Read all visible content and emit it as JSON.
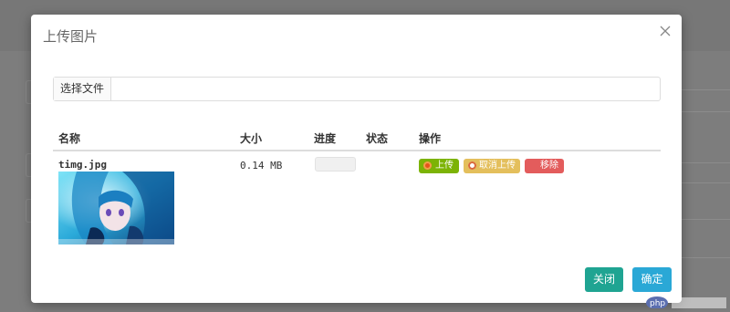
{
  "dialog": {
    "title": "上传图片",
    "close_icon": "close-icon"
  },
  "picker": {
    "button_label": "选择文件",
    "file_name": ""
  },
  "table": {
    "headers": {
      "name": "名称",
      "size": "大小",
      "progress": "进度",
      "status": "状态",
      "action": "操作"
    },
    "rows": [
      {
        "file_name": "timg.jpg",
        "file_size": "0.14 MB",
        "progress_fraction": 0,
        "status": "",
        "actions": {
          "upload": "上传",
          "cancel": "取消上传",
          "remove": "移除"
        }
      }
    ]
  },
  "footer": {
    "close_label": "关闭",
    "confirm_label": "确定"
  },
  "colors": {
    "upload": "#7cb305",
    "cancel": "#e4bf5c",
    "remove": "#e35c5c",
    "close": "#1fa492",
    "confirm": "#2aa8d6"
  }
}
